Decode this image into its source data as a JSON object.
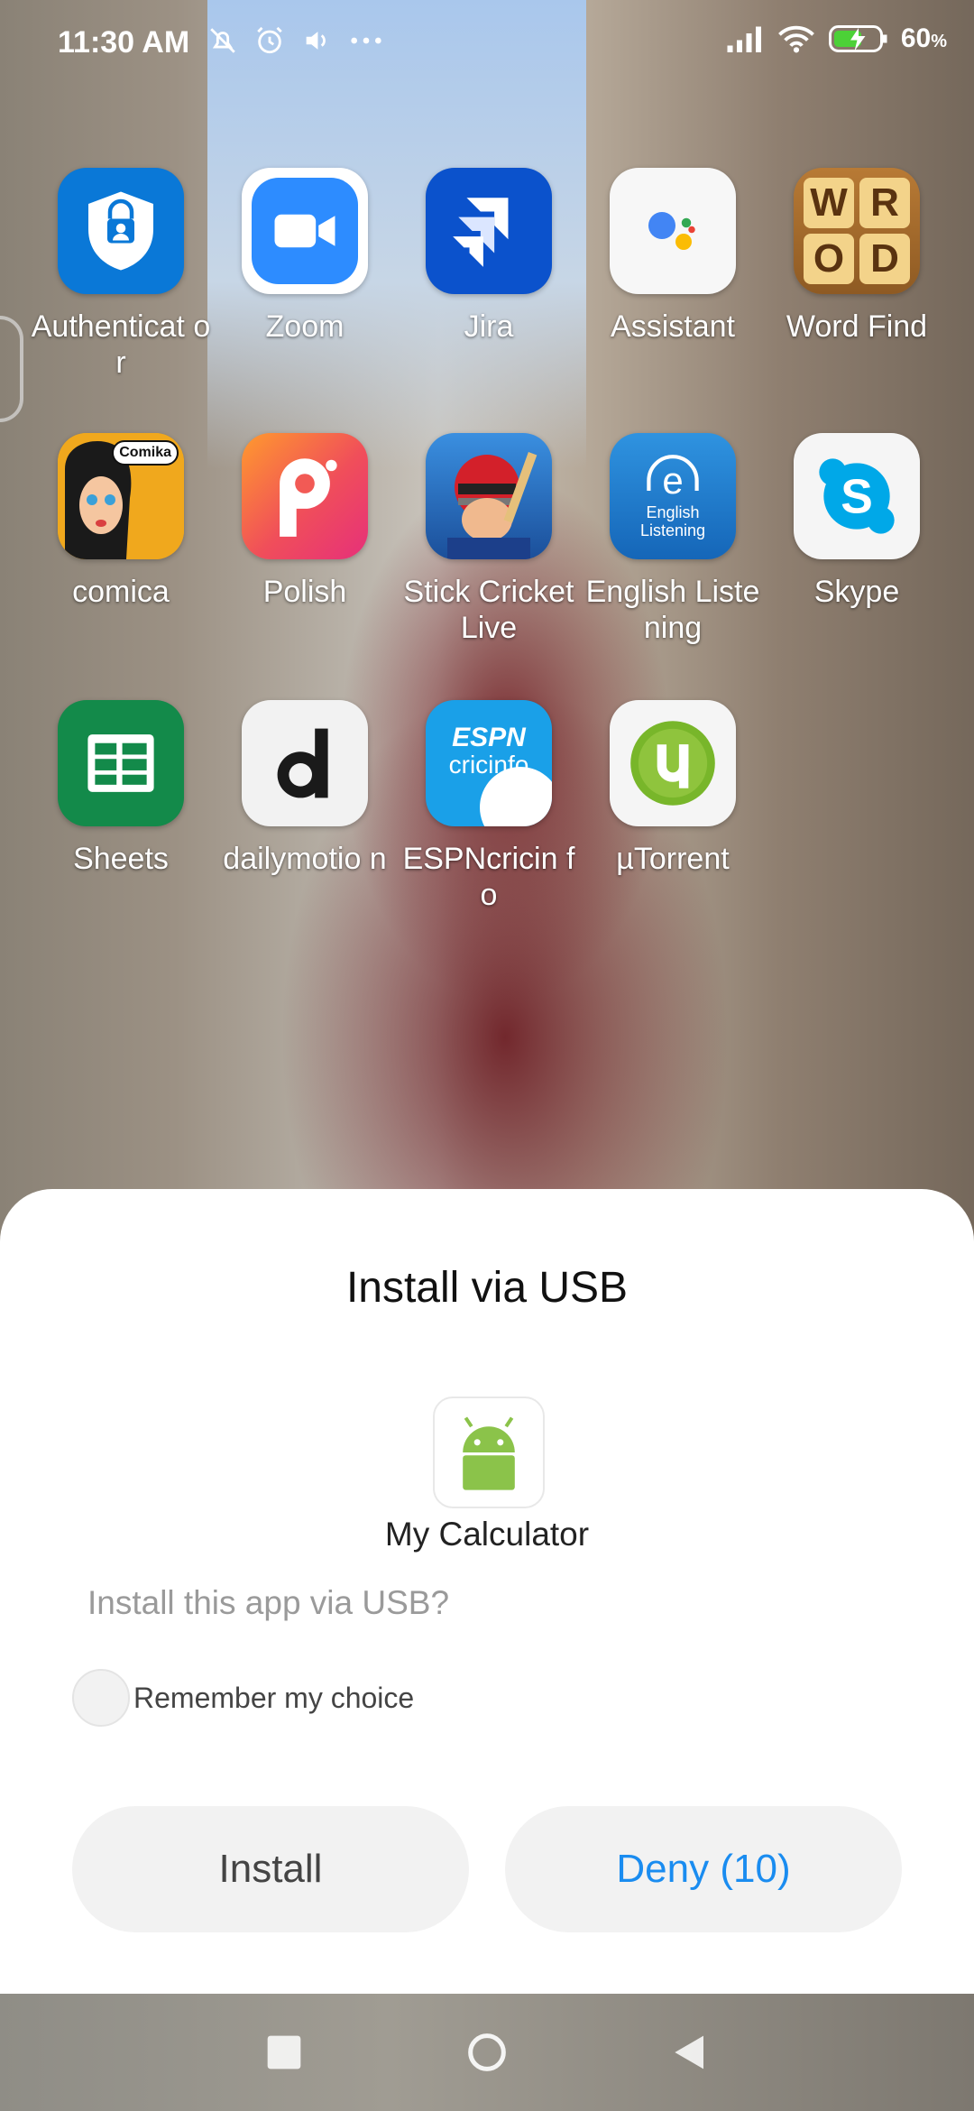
{
  "status_bar": {
    "time": "11:30 AM",
    "battery_percent": "60",
    "battery_unit": "%",
    "icons_left": [
      "mute-bell-icon",
      "alarm-icon",
      "volume-icon",
      "more-dots-icon"
    ],
    "icons_right": [
      "signal-icon",
      "wifi-icon",
      "battery-charging-icon"
    ]
  },
  "home_apps": [
    {
      "label": "Authenticat or",
      "icon": "authenticator-icon"
    },
    {
      "label": "Zoom",
      "icon": "zoom-icon"
    },
    {
      "label": "Jira",
      "icon": "jira-icon"
    },
    {
      "label": "Assistant",
      "icon": "assistant-icon"
    },
    {
      "label": "Word Find",
      "icon": "word-find-icon"
    },
    {
      "label": "comica",
      "icon": "comica-icon"
    },
    {
      "label": "Polish",
      "icon": "polish-icon"
    },
    {
      "label": "Stick Cricket Live",
      "icon": "stick-cricket-icon"
    },
    {
      "label": "English Listening",
      "icon": "english-listening-icon"
    },
    {
      "label": "Skype",
      "icon": "skype-icon"
    },
    {
      "label": "Sheets",
      "icon": "sheets-icon"
    },
    {
      "label": "dailymotio n",
      "icon": "dailymotion-icon"
    },
    {
      "label": "ESPNcricin fo",
      "icon": "espncricinfo-icon"
    },
    {
      "label": "µTorrent",
      "icon": "utorrent-icon"
    }
  ],
  "icon_text": {
    "word_find": [
      "W",
      "R",
      "O",
      "D"
    ],
    "comica": "Comika",
    "english_listening": [
      "English",
      "Listening"
    ],
    "espn": [
      "ESPN",
      "cricinfo"
    ]
  },
  "dialog": {
    "title": "Install via USB",
    "app_name": "My Calculator",
    "question": "Install this app via USB?",
    "remember_label": "Remember my choice",
    "install_label": "Install",
    "deny_label": "Deny (10)",
    "deny_color": "#1a8cf0"
  },
  "nav_bar": [
    "recents-square-icon",
    "home-circle-icon",
    "back-triangle-icon"
  ]
}
